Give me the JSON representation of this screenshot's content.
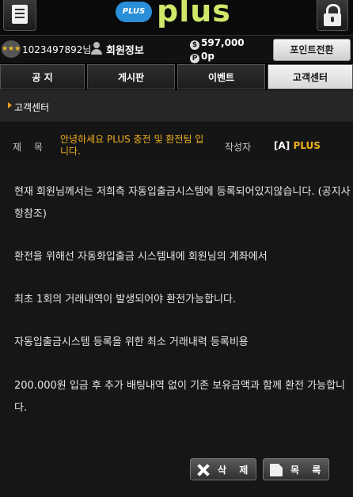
{
  "header": {
    "logo_badge": "PLUS",
    "logo_text": "plus"
  },
  "user": {
    "level_icon_label": "★★★",
    "id_text": "1023497892님",
    "member_link": "회원정보",
    "money": "597,000",
    "money_icon": "$",
    "point": "0p",
    "point_icon": "P",
    "point_button": "포인트전환"
  },
  "tabs": [
    {
      "label": "공 지"
    },
    {
      "label": "게시판"
    },
    {
      "label": "이벤트"
    },
    {
      "label": "고객센터"
    }
  ],
  "section": {
    "title": "고객센터"
  },
  "post": {
    "subject_label": "제 목",
    "subject": "안녕하세요 PLUS 충전 및 환전팀 입니다.",
    "author_label": "작성자",
    "author_grade": "[A]",
    "author_name": "PLUS",
    "paragraphs": [
      "현재 회원님께서는 저희측 자동입출금시스템에 등록되어있지않습니다. (공지사항참조)",
      "환전을 위해선 자동화입출금 시스템내에 회원님의 계좌에서",
      "최초 1회의 거래내역이 발생되어야 환전가능합니다.",
      "자동입출금시스템 등록을 위한 최소 거래내력 등록비용",
      "200.000원 입금 후 추가 배팅내역 없이 기존 보유금액과 함께 환전 가능합니다."
    ]
  },
  "buttons": {
    "delete": "삭 제",
    "list": "목 록"
  }
}
